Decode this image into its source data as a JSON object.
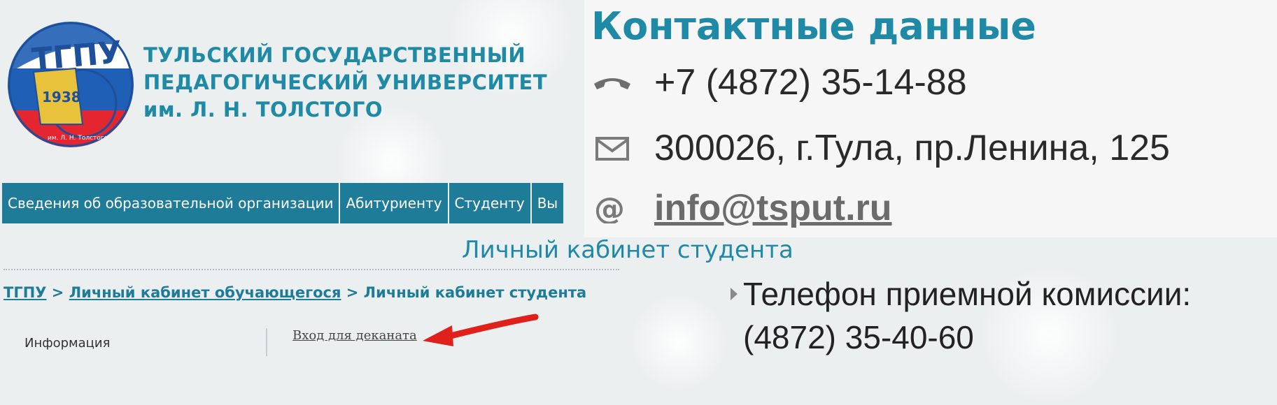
{
  "logo": {
    "text": "ТГПУ",
    "year": "1938",
    "ring_text": "им. Л. Н. Толстого"
  },
  "university": {
    "line1": "ТУЛЬСКИЙ ГОСУДАРСТВЕННЫЙ",
    "line2": "ПЕДАГОГИЧЕСКИЙ УНИВЕРСИТЕТ",
    "line3": "им. Л. Н. ТОЛСТОГО"
  },
  "nav": {
    "items": [
      {
        "label": "Сведения об образовательной организации"
      },
      {
        "label": "Абитуриенту"
      },
      {
        "label": "Студенту"
      },
      {
        "label": "Вы"
      }
    ]
  },
  "page": {
    "title": "Личный кабинет студента"
  },
  "breadcrumb": {
    "items": [
      "ТГПУ",
      "Личный кабинет обучающегося",
      "Личный кабинет студента"
    ],
    "separator": ">"
  },
  "sidebar": {
    "label": "Информация"
  },
  "dean_link": "Вход для деканата",
  "contacts": {
    "title": "Контактные данные",
    "phone": "+7 (4872) 35-14-88",
    "address": "300026, г.Тула, пр.Ленина, 125",
    "email": "info@tsput.ru"
  },
  "admission": {
    "label": "Телефон приемной комиссии:",
    "phone": "(4872) 35-40-60"
  },
  "colors": {
    "accent": "#1f8aa6",
    "nav_bg": "#1f7c99",
    "arrow": "#e0201b"
  }
}
